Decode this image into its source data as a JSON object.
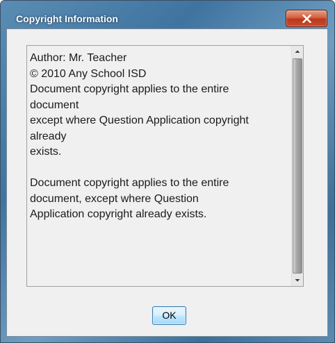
{
  "dialog": {
    "title": "Copyright Information",
    "close_icon": "close-x-icon",
    "ok_label": "OK"
  },
  "content": {
    "lines": [
      "Author: Mr. Teacher",
      "© 2010 Any School ISD",
      "Document copyright applies to the entire",
      "document",
      "except where Question Application copyright",
      "already",
      "exists.",
      "",
      "Document copyright applies to the entire",
      "document, except where Question",
      "Application copyright already exists."
    ]
  },
  "scrollbar": {
    "up_icon": "scroll-up-arrow-icon",
    "down_icon": "scroll-down-arrow-icon"
  },
  "colors": {
    "title_bar": "#4f82ac",
    "close_button": "#c94a2b",
    "dialog_background": "#f0f0f0",
    "ok_button": "#bee6fd"
  }
}
